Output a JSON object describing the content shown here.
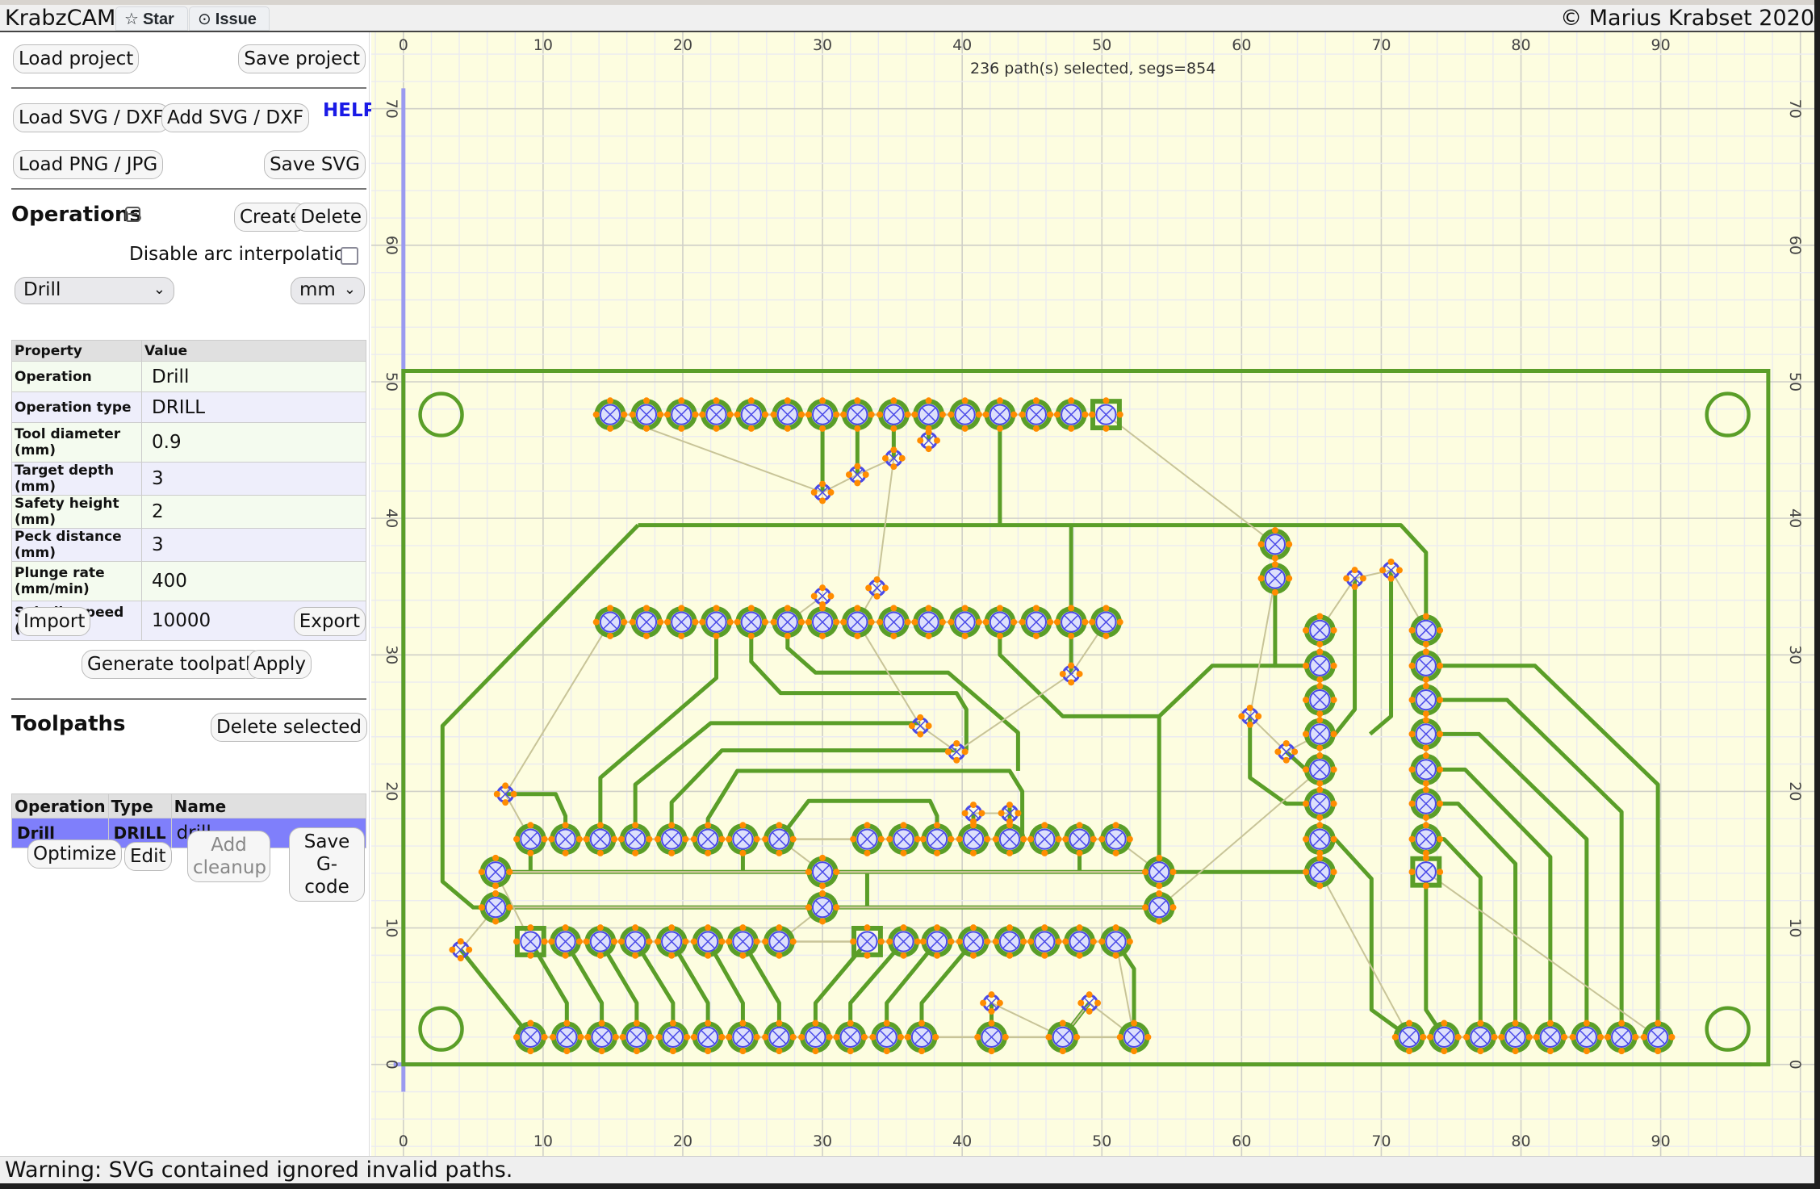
{
  "header": {
    "app_title": "KrabzCAM",
    "star_label": "Star",
    "issue_label": "Issue",
    "copyright": "© Marius Krabset 2020"
  },
  "sidebar": {
    "load_project": "Load project",
    "save_project": "Save project",
    "load_svg": "Load SVG / DXF",
    "add_svg": "Add SVG / DXF",
    "help": "HELP",
    "load_png": "Load PNG / JPG",
    "save_svg": "Save SVG",
    "operations": {
      "title": "Operations",
      "create": "Create",
      "delete": "Delete",
      "arc_label": "Disable arc interpolation",
      "arc_checked": false,
      "op_select": "Drill",
      "unit_select": "mm",
      "table_headers": [
        "Property",
        "Value"
      ],
      "properties": [
        {
          "label": "Operation",
          "value": "Drill"
        },
        {
          "label": "Operation type",
          "value": "DRILL"
        },
        {
          "label": "Tool diameter (mm)",
          "value": "0.9"
        },
        {
          "label": "Target depth (mm)",
          "value": "3"
        },
        {
          "label": "Safety height (mm)",
          "value": "2"
        },
        {
          "label": "Peck distance (mm)",
          "value": "3"
        },
        {
          "label": "Plunge rate (mm/min)",
          "value": "400"
        },
        {
          "label": "Spindle speed (rpm)",
          "value": "10000"
        }
      ],
      "import": "Import",
      "export": "Export",
      "generate": "Generate toolpath",
      "apply": "Apply"
    },
    "toolpaths": {
      "title": "Toolpaths",
      "delete_selected": "Delete selected",
      "headers": [
        "Operation",
        "Type",
        "Name"
      ],
      "rows": [
        {
          "operation": "Drill",
          "type": "DRILL",
          "name": "drill",
          "selected": true
        }
      ],
      "optimize": "Optimize",
      "edit": "Edit",
      "add_cleanup": "Add cleanup",
      "save_gcode": "Save G-code"
    }
  },
  "canvas": {
    "selection_status": "236 path(s) selected, segs=854",
    "x_ticks": [
      0,
      10,
      20,
      30,
      40,
      50,
      60,
      70,
      80,
      90
    ],
    "y_ticks": [
      0,
      10,
      20,
      30,
      40,
      50,
      60,
      70
    ],
    "x_range": [
      -2.3,
      101
    ],
    "y_range": [
      -6.7,
      75.6
    ],
    "colors": {
      "background": "#fdfde0",
      "trace": "#5a9e28",
      "origin_axis": "#9a9af0",
      "drill": "#4a4ae8",
      "marker": "#ff8c00",
      "rapid": "#c8c498"
    },
    "board_outline": [
      [
        0,
        0
      ],
      [
        97.7,
        0
      ],
      [
        97.7,
        50.8
      ],
      [
        0,
        50.8
      ]
    ],
    "mount_holes": [
      [
        2.7,
        47.6
      ],
      [
        94.8,
        47.6
      ],
      [
        2.7,
        2.6
      ],
      [
        94.8,
        2.6
      ]
    ],
    "pad_rows": [
      {
        "y": 47.6,
        "x": [
          14.8,
          17.4,
          19.9,
          22.4,
          24.9,
          27.5,
          30.0,
          32.5,
          35.1,
          37.6,
          40.2,
          42.7,
          45.3,
          47.8,
          50.3
        ],
        "square": [
          50.3
        ]
      },
      {
        "y": 32.4,
        "x": [
          14.8,
          17.4,
          19.9,
          22.4,
          24.9,
          27.5,
          30.0,
          32.5,
          35.1,
          37.6,
          40.2,
          42.7,
          45.3,
          47.8,
          50.3
        ],
        "square": []
      },
      {
        "y": 16.5,
        "x": [
          9.1,
          11.6,
          14.1,
          16.6,
          19.2,
          21.8,
          24.3,
          26.9,
          33.2,
          35.8,
          38.2,
          40.8,
          43.4,
          45.9,
          48.4,
          51.0
        ],
        "square": []
      },
      {
        "y": 9.0,
        "x": [
          9.1,
          11.6,
          14.1,
          16.6,
          19.2,
          21.8,
          24.3,
          26.9,
          33.2,
          35.8,
          38.2,
          40.8,
          43.4,
          45.9,
          48.4,
          51.0
        ],
        "square": [
          9.1,
          33.2
        ]
      },
      {
        "y": 2.0,
        "x": [
          9.1,
          11.7,
          14.2,
          16.7,
          19.3,
          21.8,
          24.3,
          26.9,
          29.5,
          32.0,
          34.6,
          37.1,
          42.1,
          47.2,
          52.3
        ],
        "square": []
      },
      {
        "y": 2.0,
        "x": [
          72.0,
          74.5,
          77.1,
          79.6,
          82.1,
          84.7,
          87.2,
          89.8
        ],
        "square": []
      },
      {
        "y": 14.1,
        "x": [
          6.6,
          30.0,
          54.1
        ],
        "square": []
      },
      {
        "y": 11.5,
        "x": [
          6.6,
          30.0,
          54.1
        ],
        "square": []
      }
    ],
    "pad_cols": [
      {
        "x": 65.6,
        "y": [
          31.8,
          29.2,
          26.7,
          24.2,
          21.6,
          19.1,
          16.5,
          14.1
        ],
        "square": []
      },
      {
        "x": 73.2,
        "y": [
          31.8,
          29.2,
          26.7,
          24.2,
          21.6,
          19.1,
          16.5,
          14.1
        ],
        "square": [
          14.1
        ]
      },
      {
        "x": 62.4,
        "y": [
          38.1,
          35.6
        ],
        "square": []
      }
    ],
    "vias": [
      [
        30.0,
        41.9
      ],
      [
        32.5,
        43.2
      ],
      [
        35.1,
        44.4
      ],
      [
        37.6,
        45.7
      ],
      [
        30.0,
        34.3
      ],
      [
        33.9,
        34.9
      ],
      [
        37.0,
        24.8
      ],
      [
        39.6,
        22.9
      ],
      [
        47.8,
        28.6
      ],
      [
        40.8,
        18.4
      ],
      [
        43.4,
        18.4
      ],
      [
        7.3,
        19.8
      ],
      [
        4.1,
        8.4
      ],
      [
        42.1,
        4.5
      ],
      [
        49.1,
        4.5
      ],
      [
        68.1,
        35.6
      ],
      [
        70.7,
        36.2
      ],
      [
        60.6,
        25.5
      ],
      [
        63.2,
        22.9
      ]
    ],
    "traces": [
      [
        [
          16.8,
          39.5
        ],
        [
          71.4,
          39.5
        ],
        [
          73.2,
          37.5
        ],
        [
          73.2,
          31.8
        ]
      ],
      [
        [
          16.8,
          39.5
        ],
        [
          2.8,
          24.8
        ],
        [
          2.8,
          13.4
        ],
        [
          5.0,
          11.5
        ],
        [
          6.6,
          11.5
        ]
      ],
      [
        [
          42.7,
          47.6
        ],
        [
          42.7,
          39.5
        ]
      ],
      [
        [
          47.8,
          39.5
        ],
        [
          47.8,
          28.6
        ]
      ],
      [
        [
          30.0,
          47.6
        ],
        [
          30.0,
          41.9
        ]
      ],
      [
        [
          32.5,
          47.6
        ],
        [
          32.5,
          43.2
        ]
      ],
      [
        [
          35.1,
          47.6
        ],
        [
          35.1,
          44.4
        ]
      ],
      [
        [
          37.6,
          47.6
        ],
        [
          37.6,
          45.7
        ]
      ],
      [
        [
          62.4,
          35.6
        ],
        [
          62.4,
          29.2
        ],
        [
          65.6,
          29.2
        ]
      ],
      [
        [
          62.4,
          29.2
        ],
        [
          57.9,
          29.2
        ],
        [
          54.1,
          25.5
        ],
        [
          54.1,
          14.1
        ]
      ],
      [
        [
          54.1,
          25.5
        ],
        [
          47.2,
          25.5
        ],
        [
          42.7,
          30.0
        ],
        [
          42.7,
          32.4
        ]
      ],
      [
        [
          6.6,
          14.1
        ],
        [
          65.6,
          14.1
        ]
      ],
      [
        [
          6.6,
          11.5
        ],
        [
          54.1,
          11.5
        ]
      ],
      [
        [
          9.1,
          16.5
        ],
        [
          9.1,
          14.1
        ]
      ],
      [
        [
          24.3,
          16.5
        ],
        [
          24.3,
          14.1
        ]
      ],
      [
        [
          48.4,
          16.5
        ],
        [
          48.4,
          14.1
        ]
      ],
      [
        [
          33.2,
          14.1
        ],
        [
          33.2,
          11.5
        ]
      ],
      [
        [
          7.3,
          19.8
        ],
        [
          10.9,
          19.8
        ],
        [
          11.6,
          18.2
        ],
        [
          11.6,
          16.5
        ]
      ],
      [
        [
          14.1,
          16.5
        ],
        [
          14.1,
          21.0
        ],
        [
          22.4,
          28.3
        ],
        [
          22.4,
          32.4
        ]
      ],
      [
        [
          16.6,
          16.5
        ],
        [
          16.6,
          20.5
        ],
        [
          22.0,
          25.0
        ],
        [
          37.0,
          25.0
        ]
      ],
      [
        [
          19.2,
          16.5
        ],
        [
          19.2,
          19.2
        ],
        [
          22.8,
          23.0
        ],
        [
          39.6,
          23.0
        ]
      ],
      [
        [
          21.8,
          16.5
        ],
        [
          21.8,
          18.0
        ],
        [
          23.9,
          21.5
        ],
        [
          43.4,
          21.5
        ],
        [
          44.3,
          20.0
        ],
        [
          44.3,
          16.5
        ]
      ],
      [
        [
          26.9,
          16.5
        ],
        [
          29.0,
          19.3
        ],
        [
          37.7,
          19.3
        ],
        [
          38.2,
          18.2
        ],
        [
          38.2,
          16.5
        ]
      ],
      [
        [
          24.9,
          32.4
        ],
        [
          24.9,
          29.5
        ],
        [
          27.0,
          27.2
        ],
        [
          39.6,
          27.2
        ],
        [
          40.3,
          26.0
        ],
        [
          40.3,
          23.0
        ]
      ],
      [
        [
          27.5,
          32.4
        ],
        [
          27.5,
          30.5
        ],
        [
          29.5,
          28.7
        ],
        [
          39.0,
          28.7
        ],
        [
          44.0,
          24.3
        ],
        [
          44.0,
          21.5
        ]
      ],
      [
        [
          40.8,
          18.4
        ],
        [
          40.8,
          16.5
        ]
      ],
      [
        [
          43.4,
          18.4
        ],
        [
          43.4,
          16.5
        ]
      ],
      [
        [
          43.4,
          18.4
        ],
        [
          43.4,
          19.0
        ]
      ],
      [
        [
          9.1,
          9.0
        ],
        [
          11.7,
          4.5
        ],
        [
          11.7,
          2.0
        ]
      ],
      [
        [
          11.6,
          9.0
        ],
        [
          14.2,
          4.5
        ],
        [
          14.2,
          2.0
        ]
      ],
      [
        [
          14.1,
          9.0
        ],
        [
          16.7,
          4.5
        ],
        [
          16.7,
          2.0
        ]
      ],
      [
        [
          16.6,
          9.0
        ],
        [
          19.3,
          4.5
        ],
        [
          19.3,
          2.0
        ]
      ],
      [
        [
          19.2,
          9.0
        ],
        [
          21.8,
          4.5
        ],
        [
          21.8,
          2.0
        ]
      ],
      [
        [
          21.8,
          9.0
        ],
        [
          24.3,
          4.5
        ],
        [
          24.3,
          2.0
        ]
      ],
      [
        [
          24.3,
          9.0
        ],
        [
          26.9,
          4.5
        ],
        [
          26.9,
          2.0
        ]
      ],
      [
        [
          4.1,
          8.4
        ],
        [
          9.1,
          2.0
        ]
      ],
      [
        [
          33.2,
          9.0
        ],
        [
          29.5,
          4.5
        ],
        [
          29.5,
          2.0
        ]
      ],
      [
        [
          35.8,
          9.0
        ],
        [
          32.0,
          4.5
        ],
        [
          32.0,
          2.0
        ]
      ],
      [
        [
          38.2,
          9.0
        ],
        [
          34.6,
          4.5
        ],
        [
          34.6,
          2.0
        ]
      ],
      [
        [
          40.8,
          9.0
        ],
        [
          37.1,
          4.5
        ],
        [
          37.1,
          2.0
        ]
      ],
      [
        [
          42.1,
          4.5
        ],
        [
          42.1,
          2.0
        ]
      ],
      [
        [
          49.1,
          4.5
        ],
        [
          47.2,
          2.0
        ]
      ],
      [
        [
          51.0,
          9.0
        ],
        [
          52.3,
          7.0
        ],
        [
          52.3,
          2.0
        ]
      ],
      [
        [
          60.6,
          25.5
        ],
        [
          60.6,
          21.0
        ],
        [
          63.2,
          19.1
        ],
        [
          65.6,
          19.1
        ]
      ],
      [
        [
          63.2,
          22.9
        ],
        [
          64.6,
          21.6
        ],
        [
          65.6,
          21.6
        ]
      ],
      [
        [
          68.1,
          35.6
        ],
        [
          68.1,
          26.0
        ],
        [
          66.7,
          24.2
        ],
        [
          65.6,
          24.2
        ]
      ],
      [
        [
          70.7,
          36.2
        ],
        [
          70.7,
          25.5
        ],
        [
          69.2,
          24.2
        ]
      ],
      [
        [
          65.6,
          16.5
        ],
        [
          66.7,
          16.5
        ],
        [
          69.3,
          13.6
        ],
        [
          69.3,
          4.0
        ],
        [
          72.0,
          2.0
        ]
      ],
      [
        [
          73.2,
          14.1
        ],
        [
          73.2,
          4.0
        ],
        [
          74.5,
          2.0
        ]
      ],
      [
        [
          73.2,
          16.5
        ],
        [
          74.5,
          16.5
        ],
        [
          77.1,
          13.7
        ],
        [
          77.1,
          2.0
        ]
      ],
      [
        [
          73.2,
          19.1
        ],
        [
          75.5,
          19.1
        ],
        [
          79.6,
          14.7
        ],
        [
          79.6,
          2.0
        ]
      ],
      [
        [
          73.2,
          21.6
        ],
        [
          76.0,
          21.6
        ],
        [
          82.1,
          15.2
        ],
        [
          82.1,
          2.0
        ]
      ],
      [
        [
          73.2,
          24.2
        ],
        [
          77.0,
          24.2
        ],
        [
          84.7,
          16.5
        ],
        [
          84.7,
          2.0
        ]
      ],
      [
        [
          73.2,
          26.7
        ],
        [
          79.0,
          26.7
        ],
        [
          87.2,
          18.5
        ],
        [
          87.2,
          2.0
        ]
      ],
      [
        [
          73.2,
          29.2
        ],
        [
          81.0,
          29.2
        ],
        [
          89.8,
          20.5
        ],
        [
          89.8,
          2.0
        ]
      ]
    ],
    "rapids": [
      [
        [
          14.8,
          47.6
        ],
        [
          30.0,
          41.9
        ],
        [
          32.5,
          43.2
        ],
        [
          35.1,
          44.4
        ],
        [
          33.9,
          34.9
        ],
        [
          32.5,
          32.4
        ]
      ],
      [
        [
          50.3,
          47.6
        ],
        [
          62.4,
          38.1
        ],
        [
          62.4,
          35.6
        ],
        [
          60.6,
          25.5
        ],
        [
          63.2,
          22.9
        ],
        [
          65.6,
          24.2
        ]
      ],
      [
        [
          14.8,
          32.4
        ],
        [
          7.3,
          19.8
        ],
        [
          9.1,
          16.5
        ]
      ],
      [
        [
          27.5,
          32.4
        ],
        [
          30.0,
          34.3
        ]
      ],
      [
        [
          32.5,
          32.4
        ],
        [
          37.0,
          24.8
        ],
        [
          39.6,
          22.9
        ],
        [
          47.8,
          28.6
        ],
        [
          50.3,
          32.4
        ]
      ],
      [
        [
          26.9,
          16.5
        ],
        [
          30.0,
          14.1
        ]
      ],
      [
        [
          6.6,
          14.1
        ],
        [
          9.1,
          9.0
        ]
      ],
      [
        [
          6.6,
          11.5
        ],
        [
          4.1,
          8.4
        ]
      ],
      [
        [
          26.9,
          9.0
        ],
        [
          30.0,
          11.5
        ]
      ],
      [
        [
          51.0,
          16.5
        ],
        [
          54.1,
          14.1
        ]
      ],
      [
        [
          54.1,
          11.5
        ],
        [
          65.6,
          21.6
        ]
      ],
      [
        [
          65.6,
          31.8
        ],
        [
          68.1,
          35.6
        ],
        [
          70.7,
          36.2
        ],
        [
          73.2,
          31.8
        ]
      ],
      [
        [
          65.6,
          14.1
        ],
        [
          72.0,
          2.0
        ]
      ],
      [
        [
          73.2,
          14.1
        ],
        [
          89.8,
          2.0
        ]
      ],
      [
        [
          37.1,
          2.0
        ],
        [
          42.1,
          2.0
        ]
      ],
      [
        [
          42.1,
          4.5
        ],
        [
          47.2,
          2.0
        ],
        [
          49.1,
          4.5
        ],
        [
          52.3,
          2.0
        ]
      ],
      [
        [
          51.0,
          9.0
        ],
        [
          52.3,
          2.0
        ]
      ],
      [
        [
          40.8,
          18.4
        ],
        [
          43.4,
          18.4
        ]
      ]
    ]
  },
  "status": {
    "message": "Warning: SVG contained ignored invalid paths."
  }
}
